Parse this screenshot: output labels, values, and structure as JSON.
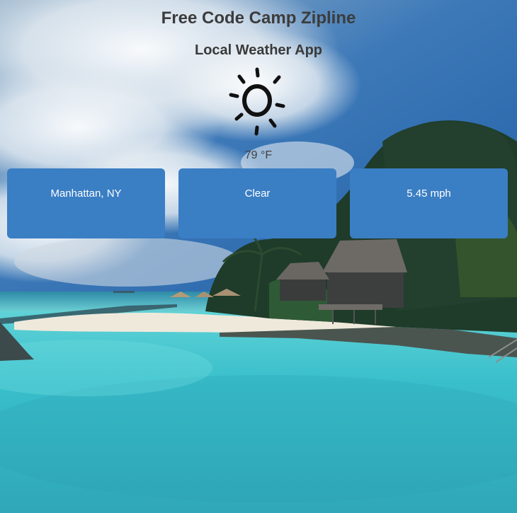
{
  "header": {
    "title": "Free Code Camp Zipline",
    "subtitle": "Local Weather App"
  },
  "weather": {
    "icon": "sun-icon",
    "temperature": "79 °F"
  },
  "cards": {
    "location": "Manhattan, NY",
    "condition": "Clear",
    "wind": "5.45 mph"
  },
  "colors": {
    "card_bg": "#3a7ec4",
    "card_text": "#ffffff",
    "sky": "#2a6fb5",
    "water": "#3fc4cf",
    "sand": "#efe9dc"
  }
}
